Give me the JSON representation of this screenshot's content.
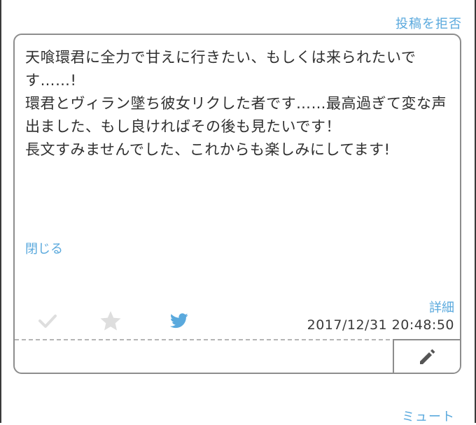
{
  "header": {
    "reject_label": "投稿を拒否"
  },
  "post": {
    "message_lines": [
      "天喰環君に全力で甘えに行きたい、もしくは来られたいです……!",
      "環君とヴィラン墜ち彼女リクした者です……最高過ぎて変な声出ました、もし良ければその後も見たいです！",
      "長文すみませんでした、これからも楽しみにしてます!"
    ],
    "close_label": "閉じる",
    "detail_label": "詳細",
    "timestamp": "2017/12/31 20:48:50",
    "actions": {
      "check_icon": "check-icon",
      "star_icon": "star-icon",
      "twitter_icon": "twitter-icon",
      "edit_icon": "pencil-icon"
    }
  },
  "footer": {
    "mute_label": "ミュート"
  },
  "colors": {
    "link": "#5aa9dd",
    "icon_gray": "#dedede",
    "border": "#8d8d8d",
    "text": "#2f2f2f"
  }
}
